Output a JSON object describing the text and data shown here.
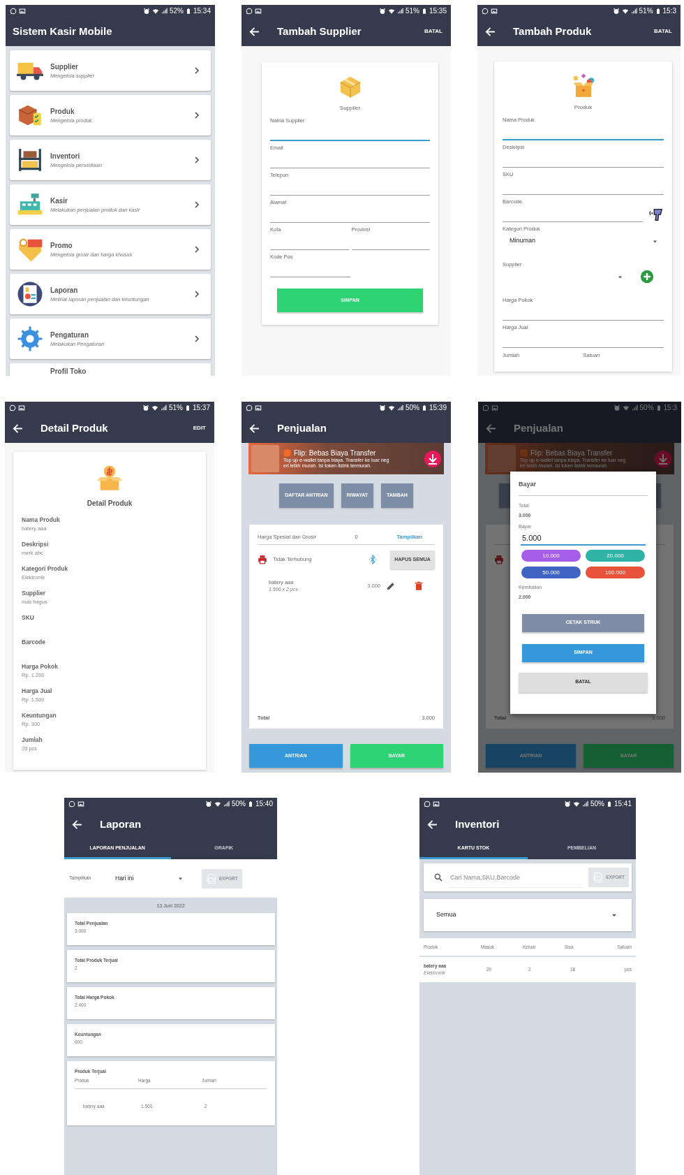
{
  "screens": [
    {
      "kind": "menu",
      "back": false,
      "status": {
        "battery": "52%",
        "time": "15:34"
      },
      "title": "Sistem Kasir Mobile",
      "items": [
        {
          "title": "Supplier",
          "subtitle": "Mengelola supplier",
          "cut": false
        },
        {
          "title": "Produk",
          "subtitle": "Mengelola produk",
          "cut": false
        },
        {
          "title": "Inventori",
          "subtitle": "Mengelola persediaan",
          "cut": false
        },
        {
          "title": "Kasir",
          "subtitle": "Melakukan penjualan produk dan kasir",
          "cut": false
        },
        {
          "title": "Promo",
          "subtitle": "Mengelola grosir dan harga khusus",
          "cut": false
        },
        {
          "title": "Laporan",
          "subtitle": "Melihat laporan penjualan dan keuntungan",
          "cut": false
        },
        {
          "title": "Pengaturan",
          "subtitle": "Melakukan Pengaturan",
          "cut": false
        },
        {
          "title": "Profil Toko",
          "cut": true
        }
      ]
    },
    {
      "kind": "form",
      "back": true,
      "status": {
        "battery": "51%",
        "time": "15:35"
      },
      "title": "Tambah Supplier",
      "action": "BATAL",
      "heading": "Supplier",
      "fields": [
        {
          "kind": "text",
          "label": "Nama Supplier",
          "focused": true
        },
        {
          "kind": "text",
          "label": "Email",
          "focused": false
        },
        {
          "kind": "text",
          "label": "Telepon",
          "focused": false
        },
        {
          "kind": "text",
          "label": "Alamat",
          "focused": false
        },
        {
          "kind": "pair",
          "fields": [
            {
              "kind": "text",
              "label": "Kota",
              "focused": false
            },
            {
              "kind": "text",
              "label": "Provinsi",
              "focused": false
            }
          ]
        },
        {
          "kind": "short",
          "label": "Kode Pos",
          "focused": false
        }
      ],
      "submit": "SIMPAN"
    },
    {
      "kind": "form",
      "back": true,
      "status": {
        "battery": "51%",
        "time": "15:3"
      },
      "title": "Tambah Produk",
      "action": "BATAL",
      "heading": "Produk",
      "fields": [
        {
          "kind": "text",
          "label": "Nama Produk",
          "focused": true
        },
        {
          "kind": "text",
          "label": "Deskripsi",
          "focused": false
        },
        {
          "kind": "text",
          "label": "SKU",
          "focused": false
        },
        {
          "kind": "barcode",
          "label": "Barcode",
          "focused": false
        },
        {
          "kind": "select",
          "label": "Kategori Produk",
          "value": "Minuman"
        },
        {
          "kind": "select_add",
          "label": "Supplier"
        },
        {
          "kind": "text",
          "label": "Harga Pokok",
          "focused": false
        },
        {
          "kind": "text",
          "label": "Harga Jual",
          "focused": false
        },
        {
          "kind": "labels",
          "labels": [
            "Jumlah",
            "Satuan"
          ]
        }
      ]
    },
    {
      "kind": "detail",
      "back": true,
      "status": {
        "battery": "51%",
        "time": "15:37"
      },
      "title": "Detail Produk",
      "action": "EDIT",
      "heading": "Detail Produk",
      "rows": [
        {
          "label": "Nama Produk",
          "value": "batery aaa"
        },
        {
          "label": "Deskripsi",
          "value": "merk abc"
        },
        {
          "label": "Kategori Produk",
          "value": "Elektronik"
        },
        {
          "label": "Supplier",
          "value": "mas bagus"
        },
        {
          "label": "SKU"
        },
        {
          "label": "Barcode"
        },
        {
          "label": "Harga Pokok",
          "value": "Rp. 1.200"
        },
        {
          "label": "Harga Jual",
          "value": "Rp. 1.500"
        },
        {
          "label": "Keuntungan",
          "value": "Rp. 300"
        },
        {
          "label": "Jumlah",
          "value": "20 pcs"
        }
      ]
    },
    {
      "kind": "sale",
      "back": true,
      "status": {
        "battery": "50%",
        "time": "15:39"
      },
      "title": "Penjualan",
      "ad": {
        "title": "Flip: Bebas Biaya Transfer",
        "lines": [
          "Top up e-wallet tanpa biaya. Transfer ke luar neg",
          "eri lebih murah. Isi token listrik termurah."
        ]
      },
      "buttons": [
        "DAFTAR ANTRIAN",
        "RIWAYAT",
        "TAMBAH"
      ],
      "special": {
        "label": "Harga Spesial dan Grosir",
        "count": "0",
        "link": "Tampilkan"
      },
      "printer": {
        "status": "Tidak Terhubung",
        "clear": "HAPUS SEMUA"
      },
      "items": [
        {
          "name": "batery aaa",
          "detail": "1.500 x 2 pcs",
          "amount": "3.000"
        }
      ],
      "total": {
        "label": "Total",
        "value": "3.000"
      },
      "footer": [
        "ANTRIAN",
        "BAYAR"
      ]
    },
    {
      "kind": "sale_dialog",
      "back": true,
      "status": {
        "battery": "50%",
        "time": "15:3"
      },
      "title": "Penjualan",
      "ad": {
        "title": "Flip: Bebas Biaya Transfer",
        "lines": [
          "Top up e-wallet tanpa biaya. Transfer ke luar neg",
          "eri lebih murah. Isi token listrik termurah."
        ]
      },
      "total": {
        "label": "Total",
        "value": "3.000"
      },
      "footer": [
        "ANTRIAN",
        "BAYAR"
      ],
      "dialog": {
        "title": "Bayar",
        "total_label": "Total",
        "total": "3.000",
        "pay_label": "Bayar",
        "pay_value": "5.000",
        "quick": [
          {
            "label": "10.000",
            "color": "#a65ee8"
          },
          {
            "label": "20.000",
            "color": "#2fb3a6"
          },
          {
            "label": "50.000",
            "color": "#4064c4"
          },
          {
            "label": "100.000",
            "color": "#e8533b"
          }
        ],
        "change_label": "Kembalian",
        "change": "2.000",
        "buttons": [
          "CETAK STRUK",
          "SIMPAN",
          "BATAL"
        ]
      }
    },
    {
      "kind": "report",
      "back": true,
      "status": {
        "battery": "50%",
        "time": "15:40"
      },
      "title": "Laporan",
      "tabs": [
        {
          "label": "LAPORAN PENJUALAN",
          "selected": true
        },
        {
          "label": "GRAFIK",
          "selected": false
        }
      ],
      "filter": {
        "label": "Tampilkan",
        "value": "Hari ini"
      },
      "export": {
        "label": "EXPORT",
        "disabled": true
      },
      "date": "13 Juni 2022",
      "stats": [
        {
          "label": "Total Penjualan",
          "value": "3.000"
        },
        {
          "label": "Total Produk Terjual",
          "value": "2"
        },
        {
          "label": "Total Harga Pokok",
          "value": "2.400"
        },
        {
          "label": "Keuntungan",
          "value": "600"
        }
      ],
      "sold": {
        "title": "Produk Terjual",
        "columns": [
          "Produk",
          "Harga",
          "Jumlah"
        ],
        "rows": [
          [
            "batery aaa",
            "1.500",
            "2"
          ]
        ]
      }
    },
    {
      "kind": "inventory",
      "back": true,
      "status": {
        "battery": "50%",
        "time": "15:41"
      },
      "title": "Inventori",
      "tabs": [
        {
          "label": "KARTU STOK",
          "selected": true
        },
        {
          "label": "PEMBELIAN",
          "selected": false
        }
      ],
      "search": {
        "placeholder": "Cari Nama,SKU,Barcode"
      },
      "export": {
        "label": "EXPORT",
        "disabled": true
      },
      "filter": {
        "value": "Semua"
      },
      "table": {
        "columns": [
          "Produk",
          "Masuk",
          "Keluar",
          "Sisa",
          "Satuan"
        ],
        "rows": [
          {
            "category": "Elektronik",
            "cells": [
              "batery aaa",
              "20",
              "2",
              "18",
              "pcs"
            ]
          }
        ]
      }
    }
  ]
}
